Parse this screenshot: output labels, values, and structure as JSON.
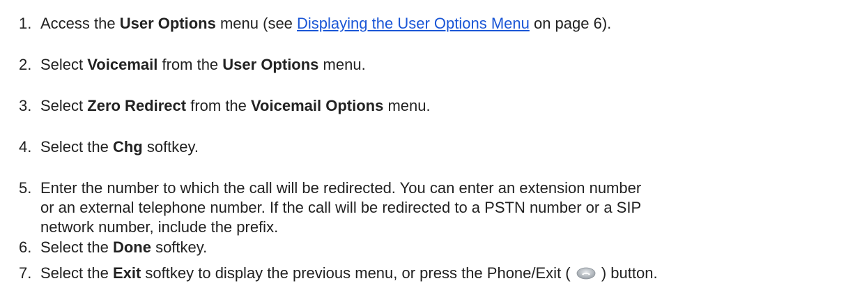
{
  "steps": [
    {
      "num": "1.",
      "t1": "Access the ",
      "b1": "User Options",
      "t2": " menu (see ",
      "link": "Displaying the User Options Menu",
      "t3": " on page 6)."
    },
    {
      "num": "2.",
      "t1": "Select ",
      "b1": "Voicemail",
      "t2": " from the ",
      "b2": "User Options",
      "t3": " menu."
    },
    {
      "num": "3.",
      "t1": "Select ",
      "b1": "Zero Redirect",
      "t2": " from the ",
      "b2": "Voicemail Options",
      "t3": " menu."
    },
    {
      "num": "4.",
      "t1": "Select the ",
      "b1": "Chg",
      "t2": " softkey."
    },
    {
      "num": "5.",
      "line1": "Enter the number to which the call will be redirected. You can enter an extension number",
      "line2": "or an external telephone number. If the call will be redirected to a PSTN number or a SIP",
      "line3": "network number, include the prefix."
    },
    {
      "num": "6.",
      "t1": "Select the ",
      "b1": "Done",
      "t2": " softkey."
    },
    {
      "num": "7.",
      "t1": "Select the ",
      "b1": "Exit",
      "t2": " softkey to display the previous menu, or press the Phone/Exit ( ",
      "icon": "phone-exit-button-icon",
      "t3": " ) button."
    }
  ],
  "colors": {
    "text": "#222222",
    "link": "#1a56d6",
    "icon_fill": "#b9bec4"
  }
}
